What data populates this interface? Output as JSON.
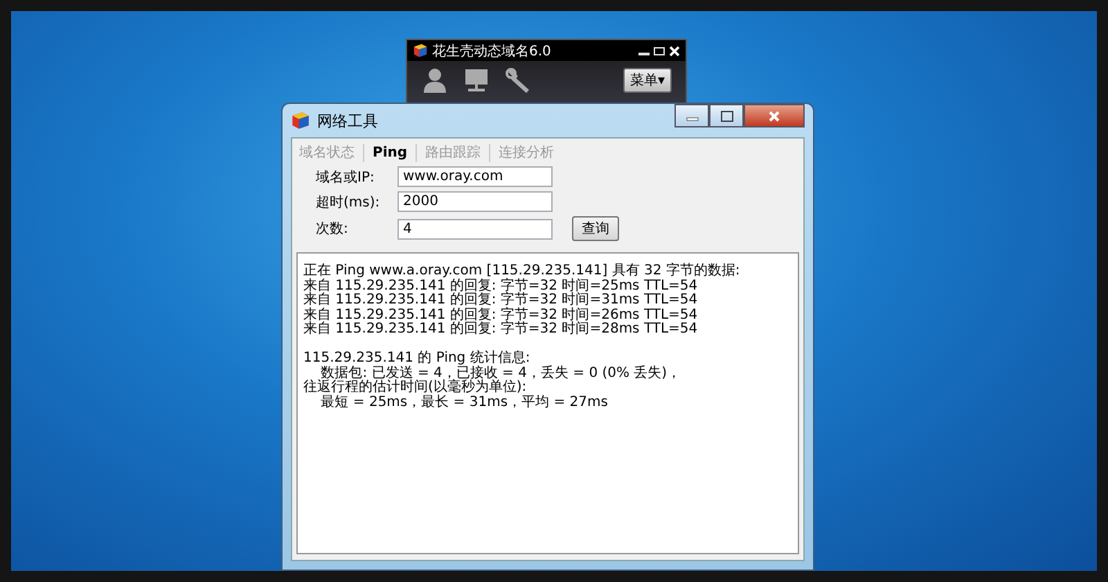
{
  "back_window": {
    "title": "花生壳动态域名6.0",
    "menu_button": "菜单▾"
  },
  "window": {
    "title": "网络工具"
  },
  "tabs": [
    {
      "label": "域名状态",
      "selected": false
    },
    {
      "label": "Ping",
      "selected": true
    },
    {
      "label": "路由跟踪",
      "selected": false
    },
    {
      "label": "连接分析",
      "selected": false
    }
  ],
  "fields": [
    {
      "label": "域名或IP:",
      "value": "www.oray.com"
    },
    {
      "label": "超时(ms):",
      "value": "2000"
    },
    {
      "label": "次数:",
      "value": "4"
    }
  ],
  "query_button": "查询",
  "output": [
    [
      "正在 Ping www.a.oray.com [115.29.235.141] 具有 32 字节的数据:",
      "来自 115.29.235.141 的回复: 字节=32 时间=25ms TTL=54",
      "来自 115.29.235.141 的回复: 字节=32 时间=31ms TTL=54",
      "来自 115.29.235.141 的回复: 字节=32 时间=26ms TTL=54",
      "来自 115.29.235.141 的回复: 字节=32 时间=28ms TTL=54"
    ],
    [
      "115.29.235.141 的 Ping 统计信息:",
      "    数据包: 已发送 = 4，已接收 = 4，丢失 = 0 (0% 丢失)，",
      "往返行程的估计时间(以毫秒为单位):",
      "    最短 = 25ms，最长 = 31ms，平均 = 27ms"
    ]
  ]
}
